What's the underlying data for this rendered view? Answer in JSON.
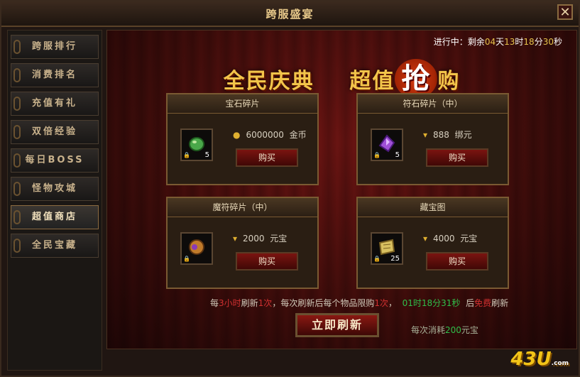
{
  "window": {
    "title": "跨服盛宴",
    "close_glyph": "✕"
  },
  "sidebar": {
    "items": [
      "跨服排行",
      "消费排名",
      "充值有礼",
      "双倍经验",
      "每日BOSS",
      "怪物攻城",
      "超值商店",
      "全民宝藏"
    ],
    "active_index": 6
  },
  "countdown": {
    "prefix": "进行中：剩余",
    "days": "04",
    "d_unit": "天",
    "hours": "13",
    "h_unit": "时",
    "minutes": "18",
    "m_unit": "分",
    "seconds": "30",
    "s_unit": "秒"
  },
  "banner": {
    "left": "全民庆典",
    "middle": "超值",
    "grab": "抢",
    "right": "购"
  },
  "cards": [
    {
      "title": "宝石碎片",
      "qty": "5",
      "price": "6000000",
      "currency": "金币",
      "currency_icon": "gold-coin-icon",
      "item_icon": "green-gem-icon",
      "item_color": "#4aa84a",
      "buy_label": "购买"
    },
    {
      "title": "符石碎片（中）",
      "qty": "5",
      "price": "888",
      "currency": "绑元",
      "currency_icon": "bound-ingot-icon",
      "item_icon": "purple-crystal-icon",
      "item_color": "#a050d8",
      "buy_label": "购买"
    },
    {
      "title": "魔符碎片（中）",
      "qty": "",
      "price": "2000",
      "currency": "元宝",
      "currency_icon": "ingot-icon",
      "item_icon": "amulet-icon",
      "item_color": "#c07a2a",
      "buy_label": "购买"
    },
    {
      "title": "藏宝图",
      "qty": "25",
      "price": "4000",
      "currency": "元宝",
      "currency_icon": "ingot-icon",
      "item_icon": "treasure-map-icon",
      "item_color": "#d8c060",
      "buy_label": "购买"
    }
  ],
  "info": {
    "p1": "每",
    "hours": "3小时",
    "p2": "刷新",
    "times1": "1次",
    "p3": "，每次刷新后每个物品限购",
    "times2": "1次",
    "p4": "，",
    "timer": "01时18分31秒",
    "p5": "后",
    "free": "免费",
    "p6": "刷新"
  },
  "refresh_button": "立即刷新",
  "cost": {
    "p1": "每次消耗",
    "amount": "200",
    "p2": "元宝"
  },
  "logo": {
    "text": "43U",
    "sub": ".com"
  },
  "colors": {
    "accent_gold": "#f2c44a",
    "highlight_red": "#d03030",
    "highlight_green": "#2fbf4a"
  }
}
